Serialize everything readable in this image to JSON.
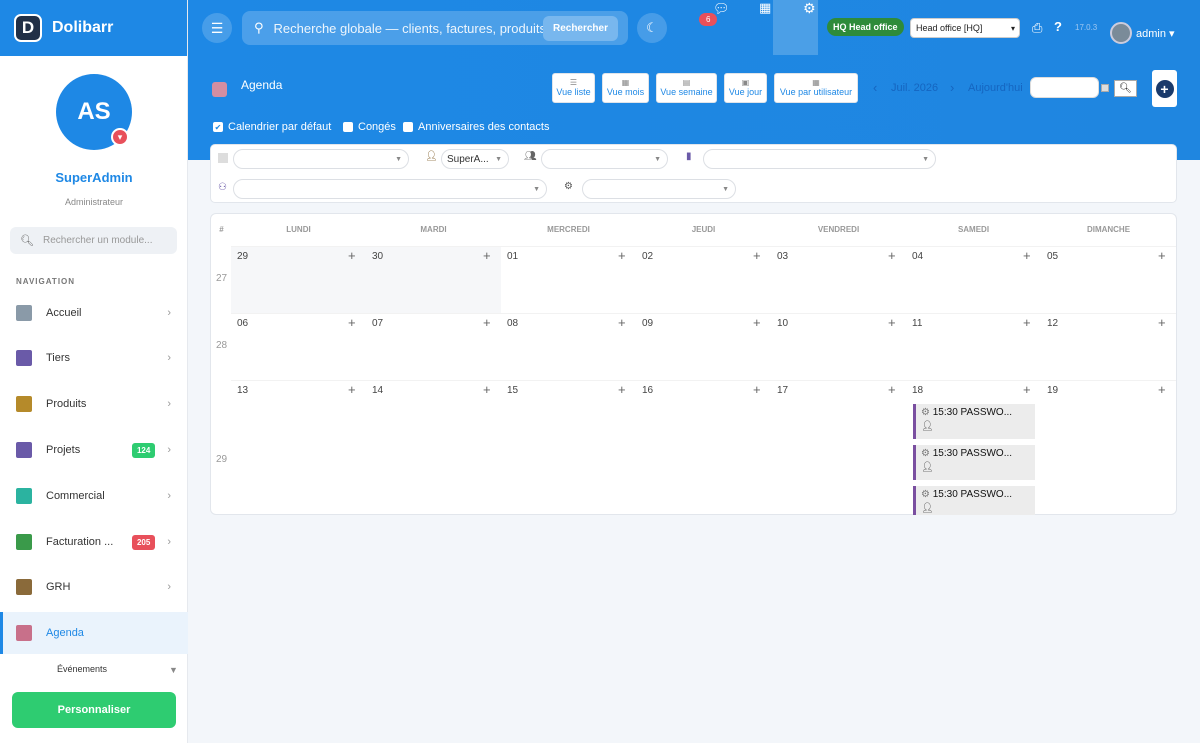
{
  "app": {
    "name": "Dolibarr",
    "logo": "D"
  },
  "user": {
    "initials": "AS",
    "name": "SuperAdmin",
    "role": "Administrateur",
    "top_name": "admin"
  },
  "sidebar": {
    "search_placeholder": "Rechercher un module...",
    "nav_label": "NAVIGATION",
    "items": [
      {
        "label": "Accueil",
        "icon": "home-icon",
        "color": "#8a9aa8"
      },
      {
        "label": "Tiers",
        "icon": "building-icon",
        "color": "#6a5aa8"
      },
      {
        "label": "Produits",
        "icon": "box-icon",
        "color": "#b58a2a"
      },
      {
        "label": "Projets",
        "icon": "project-icon",
        "color": "#6a5aa8",
        "badge": "124",
        "badge_color": "#2ecc71"
      },
      {
        "label": "Commercial",
        "icon": "briefcase-icon",
        "color": "#2bb3a0"
      },
      {
        "label": "Facturation ...",
        "icon": "invoice-icon",
        "color": "#3a9a4a",
        "badge": "205",
        "badge_color": "#e8505b"
      },
      {
        "label": "GRH",
        "icon": "person-icon",
        "color": "#8a6a3a"
      },
      {
        "label": "Agenda",
        "icon": "calendar-icon",
        "color": "#c8708a"
      }
    ],
    "sub_item": "Événements",
    "customize": "Personnaliser"
  },
  "topbar": {
    "search_placeholder": "Recherche globale — clients, factures, produits",
    "search_button": "Rechercher",
    "notif_count": "6",
    "entity_badge": "HQ Head office",
    "entity_select": "Head office [HQ]",
    "version": "17.0.3"
  },
  "agenda": {
    "title": "Agenda",
    "views": [
      "Vue liste",
      "Vue mois",
      "Vue semaine",
      "Vue jour",
      "Vue par utilisateur"
    ],
    "current_period": "Juil. 2026",
    "today": "Aujourd'hui",
    "checkboxes": [
      {
        "label": "Calendrier par défaut",
        "checked": true
      },
      {
        "label": "Congés",
        "checked": false
      },
      {
        "label": "Anniversaires des contacts",
        "checked": false
      }
    ],
    "filter_user": "SuperA...",
    "week_col": "#",
    "days": [
      "LUNDI",
      "MARDI",
      "MERCREDI",
      "JEUDI",
      "VENDREDI",
      "SAMEDI",
      "DIMANCHE"
    ],
    "weeks": [
      {
        "num": "27",
        "dates": [
          "29",
          "30",
          "01",
          "02",
          "03",
          "04",
          "05"
        ]
      },
      {
        "num": "28",
        "dates": [
          "06",
          "07",
          "08",
          "09",
          "10",
          "11",
          "12"
        ]
      },
      {
        "num": "29",
        "dates": [
          "13",
          "14",
          "15",
          "16",
          "17",
          "18",
          "19"
        ]
      }
    ],
    "events": [
      {
        "time_title": "15:30 PASSWO..."
      },
      {
        "time_title": "15:30 PASSWO..."
      },
      {
        "time_title": "15:30 PASSWO..."
      }
    ]
  }
}
